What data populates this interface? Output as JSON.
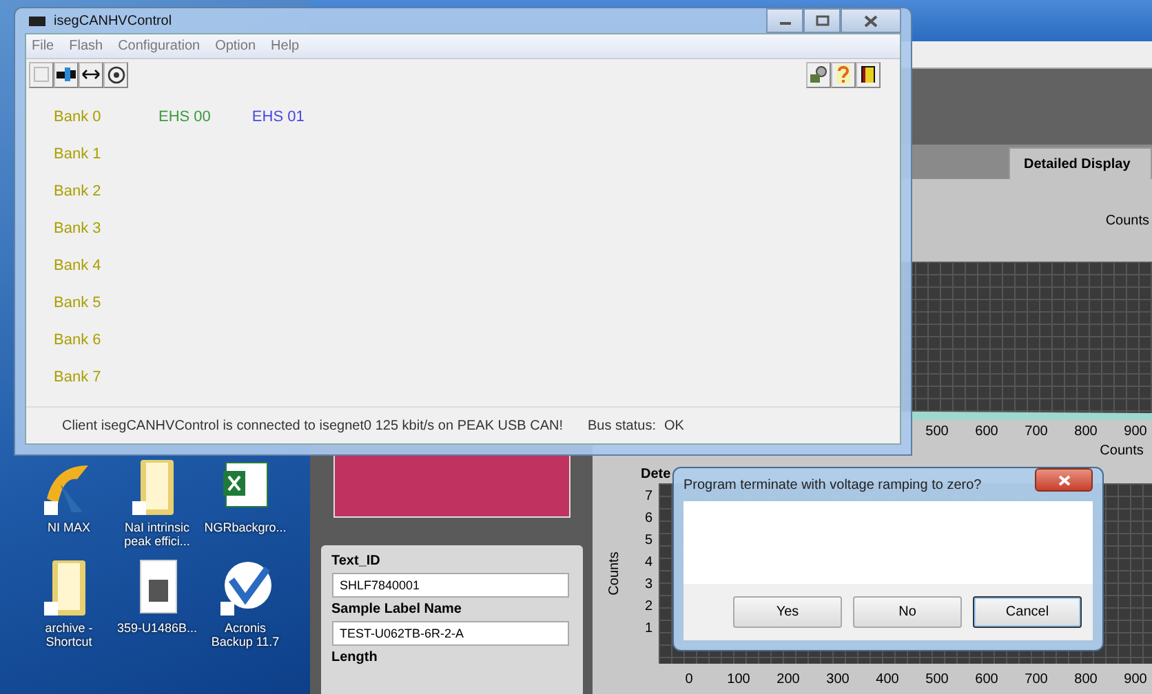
{
  "desktop_icons": [
    {
      "label": "NI MAX",
      "kind": "app"
    },
    {
      "label": "NaI intrinsic peak effici...",
      "kind": "folder"
    },
    {
      "label": "NGRbackgro...",
      "kind": "sheet"
    },
    {
      "label": "archive - Shortcut",
      "kind": "folder"
    },
    {
      "label": "359-U1486B...",
      "kind": "document"
    },
    {
      "label": "Acronis Backup 11.7",
      "kind": "backup"
    }
  ],
  "background_app": {
    "tab": "Detailed Display",
    "counts_label": "Counts",
    "top_chart": {
      "x_ticks": [
        "500",
        "600",
        "700",
        "800",
        "900"
      ],
      "side_label": "Counts"
    },
    "lower_chart": {
      "title": "Dete",
      "y_label": "Counts",
      "y_ticks": [
        "7",
        "6",
        "5",
        "4",
        "3",
        "2",
        "1"
      ],
      "x_ticks": [
        "0",
        "100",
        "200",
        "300",
        "400",
        "500",
        "600",
        "700",
        "800",
        "900"
      ]
    },
    "sample_form": {
      "fields": [
        {
          "label": "Text_ID",
          "value": "SHLF7840001"
        },
        {
          "label": "Sample Label Name",
          "value": "TEST-U062TB-6R-2-A"
        },
        {
          "label": "Length"
        }
      ]
    }
  },
  "main_window": {
    "title": "isegCANHVControl",
    "menu": [
      "File",
      "Flash",
      "Configuration",
      "Option",
      "Help"
    ],
    "banks": [
      {
        "label": "Bank 0",
        "modules": [
          {
            "label": "EHS 00",
            "color": "#3c9a3c"
          },
          {
            "label": "EHS 01",
            "color": "#4848e0"
          }
        ]
      },
      {
        "label": "Bank 1"
      },
      {
        "label": "Bank 2"
      },
      {
        "label": "Bank 3"
      },
      {
        "label": "Bank 4"
      },
      {
        "label": "Bank 5"
      },
      {
        "label": "Bank 6"
      },
      {
        "label": "Bank 7"
      }
    ],
    "status": {
      "message": "Client isegCANHVControl is connected to isegnet0 125 kbit/s on PEAK USB CAN!",
      "bus_label": "Bus status:",
      "bus_value": "OK"
    }
  },
  "dialog": {
    "title": "Program terminate with voltage ramping to zero?",
    "buttons": [
      {
        "label": "Yes",
        "default": false
      },
      {
        "label": "No",
        "default": false
      },
      {
        "label": "Cancel",
        "default": true
      }
    ]
  }
}
